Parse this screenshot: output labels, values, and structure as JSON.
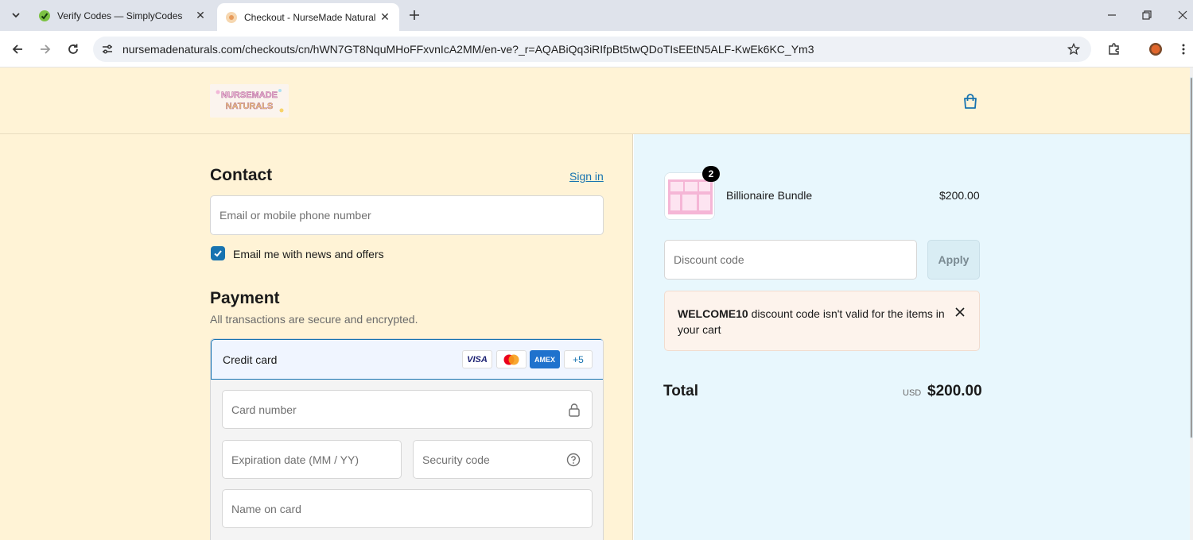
{
  "browser": {
    "tabs": [
      {
        "title": "Verify Codes — SimplyCodes",
        "active": false
      },
      {
        "title": "Checkout - NurseMade Natural",
        "active": true
      }
    ],
    "url": "nursemadenaturals.com/checkouts/cn/hWN7GT8NquMHoFFxvnIcA2MM/en-ve?_r=AQABiQq3iRIfpBt5twQDoTIsEEtN5ALF-KwEk6KC_Ym3"
  },
  "store": {
    "logo_text": "NURSEMADE NATURALS"
  },
  "contact": {
    "heading": "Contact",
    "sign_in": "Sign in",
    "email_placeholder": "Email or mobile phone number",
    "newsletter_label": "Email me with news and offers",
    "newsletter_checked": true
  },
  "payment": {
    "heading": "Payment",
    "subtitle": "All transactions are secure and encrypted.",
    "method_label": "Credit card",
    "card_brands": [
      "VISA",
      "Mastercard",
      "AMEX"
    ],
    "more_brands": "+5",
    "card_number_placeholder": "Card number",
    "expiration_placeholder": "Expiration date (MM / YY)",
    "security_placeholder": "Security code",
    "name_placeholder": "Name on card"
  },
  "order": {
    "item_name": "Billionaire Bundle",
    "item_quantity": "2",
    "item_price": "$200.00",
    "discount_placeholder": "Discount code",
    "apply_label": "Apply",
    "error_code": "WELCOME10",
    "error_message": " discount code isn't valid for the items in your cart",
    "total_label": "Total",
    "currency": "USD",
    "total_amount": "$200.00"
  },
  "colors": {
    "header_bg": "#fff3d6",
    "summary_bg": "#e8f7fd",
    "accent": "#1773b0"
  }
}
